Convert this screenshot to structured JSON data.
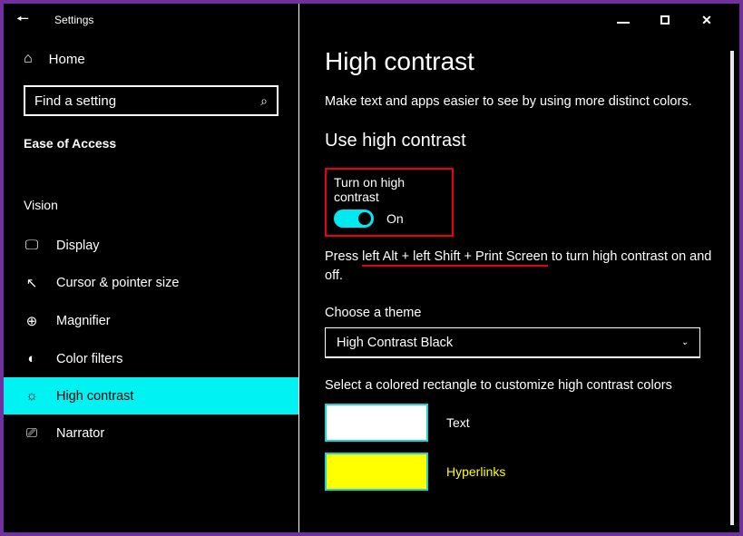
{
  "titlebar": {
    "app_name": "Settings"
  },
  "sidebar": {
    "home": "Home",
    "search_placeholder": "Find a setting",
    "category": "Ease of Access",
    "section": "Vision",
    "items": [
      {
        "label": "Display"
      },
      {
        "label": "Cursor & pointer size"
      },
      {
        "label": "Magnifier"
      },
      {
        "label": "Color filters"
      },
      {
        "label": "High contrast"
      },
      {
        "label": "Narrator"
      }
    ]
  },
  "main": {
    "heading": "High contrast",
    "description": "Make text and apps easier to see by using more distinct colors.",
    "section_heading": "Use high contrast",
    "toggle": {
      "label": "Turn on high contrast",
      "state": "On"
    },
    "hotkey_prefix": "Press ",
    "hotkey_keys": "left Alt + left Shift + Print Screen",
    "hotkey_suffix": " to turn high contrast on and off.",
    "theme_label": "Choose a theme",
    "theme_value": "High Contrast Black",
    "customize_label": "Select a colored rectangle to customize high contrast colors",
    "swatches": [
      {
        "label": "Text"
      },
      {
        "label": "Hyperlinks"
      }
    ]
  }
}
